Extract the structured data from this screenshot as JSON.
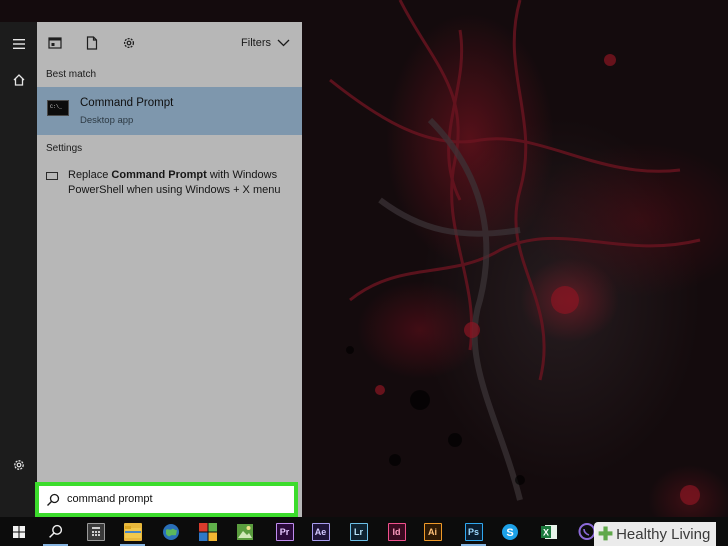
{
  "panel": {
    "filters_label": "Filters",
    "best_match_label": "Best match",
    "best_match": {
      "title": "Command Prompt",
      "subtitle": "Desktop app"
    },
    "settings_label": "Settings",
    "setting": {
      "prefix": "Replace ",
      "bold": "Command Prompt",
      "suffix": " with Windows PowerShell when using Windows + X menu"
    }
  },
  "search": {
    "value": "command prompt"
  },
  "taskbar": {
    "apps": [
      {
        "name": "Premiere",
        "abbr": "Pr"
      },
      {
        "name": "After Effects",
        "abbr": "Ae"
      },
      {
        "name": "Lightroom",
        "abbr": "Lr"
      },
      {
        "name": "InDesign",
        "abbr": "Id"
      },
      {
        "name": "Illustrator",
        "abbr": "Ai"
      },
      {
        "name": "Photoshop",
        "abbr": "Ps"
      }
    ]
  },
  "watermark": {
    "text": "Healthy Living"
  },
  "colors": {
    "accent_highlight": "#3cdc2c",
    "selection": "#7e97ad",
    "panel_bg": "#b7b7b7"
  }
}
